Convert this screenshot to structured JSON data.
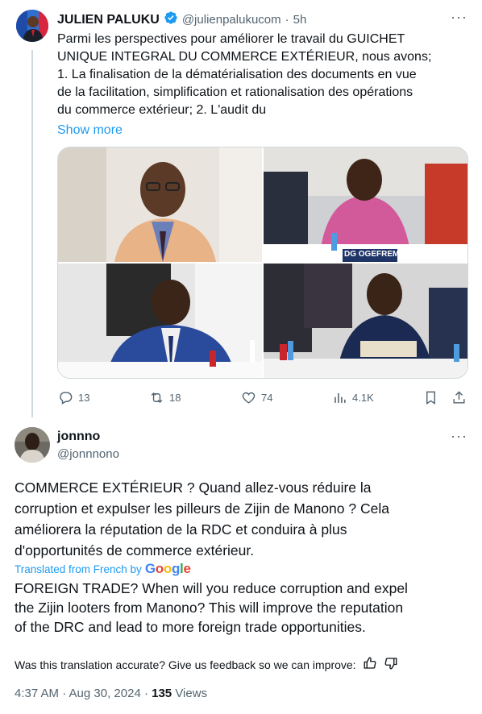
{
  "tweet": {
    "author_name": "JULIEN PALUKU",
    "handle": "@julienpalukucom",
    "time": "5h",
    "text_lines": [
      "Parmi les perspectives pour améliorer le travail du GUICHET",
      "UNIQUE INTEGRAL DU COMMERCE EXTÉRIEUR, nous avons;",
      "1. La finalisation de la dématérialisation des documents en vue",
      "de la facilitation, simplification et rationalisation des opérations",
      "du commerce extérieur; 2. L'audit du"
    ],
    "show_more": "Show more",
    "photo_labels": {
      "sign_2": "DG OGEFREM"
    },
    "stats": {
      "replies": "13",
      "retweets": "18",
      "likes": "74",
      "views": "4.1K"
    }
  },
  "reply": {
    "author_name": "jonnno",
    "handle": "@jonnnono",
    "text_lines": [
      "COMMERCE EXTÉRIEUR ? Quand allez-vous réduire la",
      "corruption et expulser les pilleurs de Zijin de Manono ? Cela",
      "améliorera la réputation de la RDC et conduira à plus",
      "d'opportunités de commerce extérieur."
    ],
    "translated_from": "Translated from French by",
    "google": "Google",
    "translation_lines": [
      "FOREIGN TRADE? When will you reduce corruption and expel",
      "the Zijin looters from Manono? This will improve the reputation",
      "of the DRC and lead to more foreign trade opportunities."
    ],
    "feedback_question": "Was this translation accurate? Give us feedback so we can improve:",
    "timestamp": "4:37 AM · Aug 30, 2024 · ",
    "views_count": "135",
    "views_label": " Views"
  },
  "icons": {
    "verified": "verified-badge-icon",
    "more": "more-dots-icon",
    "reply": "reply-icon",
    "retweet": "retweet-icon",
    "like": "heart-icon",
    "views": "views-chart-icon",
    "bookmark": "bookmark-icon",
    "share": "share-icon",
    "thumbs_up": "thumbs-up-icon",
    "thumbs_down": "thumbs-down-icon"
  },
  "colors": {
    "link": "#1d9bf0",
    "muted": "#536471",
    "text": "#0f1419",
    "border": "#cfd9de"
  }
}
